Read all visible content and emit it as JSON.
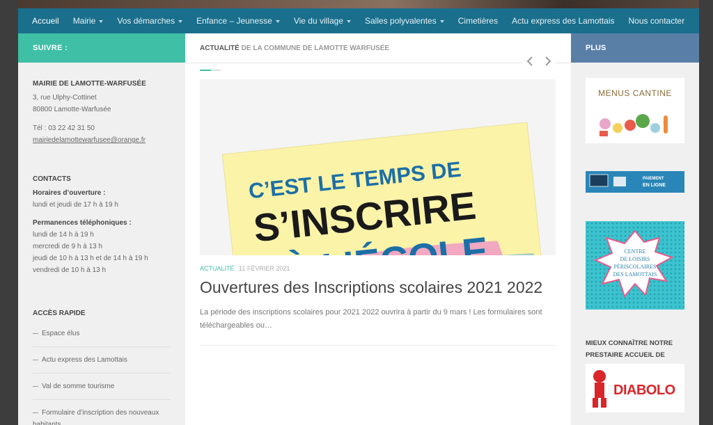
{
  "nav": {
    "items": [
      {
        "label": "Accueil",
        "dropdown": false,
        "active": true
      },
      {
        "label": "Mairie",
        "dropdown": true
      },
      {
        "label": "Vos démarches",
        "dropdown": true
      },
      {
        "label": "Enfance – Jeunesse",
        "dropdown": true
      },
      {
        "label": "Vie du village",
        "dropdown": true
      },
      {
        "label": "Salles polyvalentes",
        "dropdown": true
      },
      {
        "label": "Cimetières",
        "dropdown": false
      },
      {
        "label": "Actu express des Lamottais",
        "dropdown": false
      },
      {
        "label": "Nous contacter",
        "dropdown": false
      }
    ]
  },
  "left": {
    "header": "SUIVRE :",
    "mairie": {
      "title": "MAIRIE DE LAMOTTE-WARFUSÉE",
      "address1": "3, rue Ulphy-Cottinet",
      "address2": "80800 Lamotte-Warfusée",
      "tel": "Tél : 03 22 42 31 50",
      "email": "mairiedelamottewarfusee@orange.fr"
    },
    "contacts": {
      "title": "CONTACTS",
      "hours_title": "Horaires d’ouverture :",
      "hours": "lundi et jeudi de 17  h à 19 h",
      "perm_title": "Permanences téléphoniques :",
      "perm": [
        "lundi de 14 h à 19 h",
        "mercredi de 9 h à 13 h",
        "jeudi de 10 h à 13 h et de 14 h à 19 h",
        "vendredi de 10 h à 13 h"
      ]
    },
    "quick": {
      "title": "ACCÈS RAPIDE",
      "items": [
        "Espace élus",
        "Actu express des Lamottais",
        "Val de somme tourisme",
        "Formulaire d’inscription des nouveaux habitants"
      ]
    }
  },
  "main": {
    "heading_strong": "ACTUALITÉ",
    "heading_light": "DE LA COMMUNE DE LAMOTTE WARFUSÉE",
    "feature_image": {
      "line1": "C’EST LE TEMPS DE",
      "line2": "S’INSCRIRE",
      "line3": "À L’ÉCOLE"
    },
    "post": {
      "category": "ACTUALITÉ",
      "date": "11 FÉVRIER 2021",
      "title": "Ouvertures des Inscriptions scolaires 2021 2022",
      "excerpt": "La période des inscriptions scolaires pour 2021 2022 ouvrira à partir du 9 mars ! Les formulaires sont téléchargeables ou…"
    }
  },
  "right": {
    "header": "PLUS",
    "menus_cantine": "MENUS CANTINE",
    "paiement_line1": "PAIEMENT",
    "paiement_line2": "EN LIGNE",
    "centre": [
      "CENTRE",
      "DE LOISIRS",
      "PÉRISCOLAIRES",
      "DES LAMOTTAIS"
    ],
    "prestataire_title": "MIEUX CONNAÎTRE NOTRE PRESTAIRE ACCUEIL DE LOISIRS :",
    "diabolo": "DIABOLO"
  },
  "colors": {
    "nav_bg": "#1a6f8c",
    "left_header": "#3fbfa5",
    "right_header": "#5a7fa7",
    "accent": "#3fbfa5"
  }
}
